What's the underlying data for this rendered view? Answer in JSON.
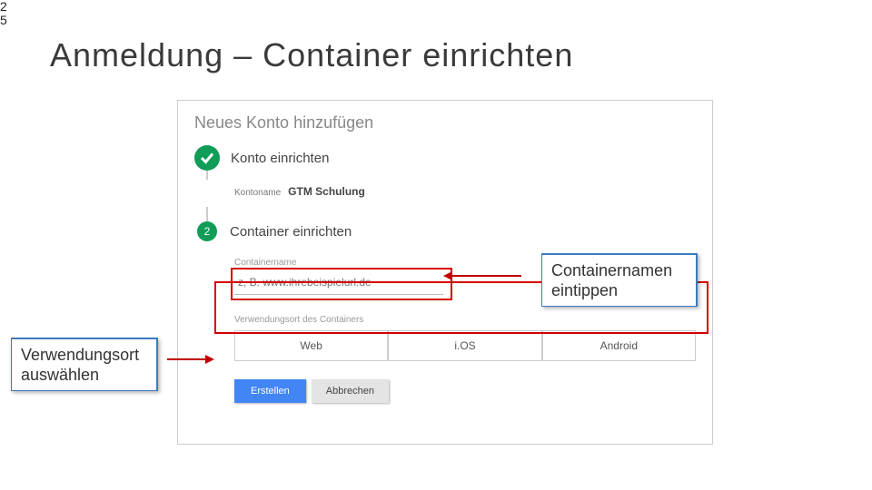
{
  "slide": {
    "number_top": "2",
    "number_bottom": "5",
    "title": "Anmeldung – Container einrichten"
  },
  "panel": {
    "title": "Neues Konto hinzufügen",
    "step1": {
      "label": "Konto einrichten",
      "kontoname_label": "Kontoname",
      "kontoname_value": "GTM Schulung"
    },
    "step2": {
      "number": "2",
      "label": "Container einrichten",
      "containername_label": "Containername",
      "containername_placeholder": "z, B. www.ihrebeispielurl.de",
      "usage_label": "Verwendungsort des Containers",
      "options": {
        "web": "Web",
        "ios": "i.OS",
        "android": "Android"
      }
    },
    "actions": {
      "create": "Erstellen",
      "cancel": "Abbrechen"
    }
  },
  "callouts": {
    "name": "Containernamen eintippen",
    "usage": "Verwendungsort auswählen"
  }
}
